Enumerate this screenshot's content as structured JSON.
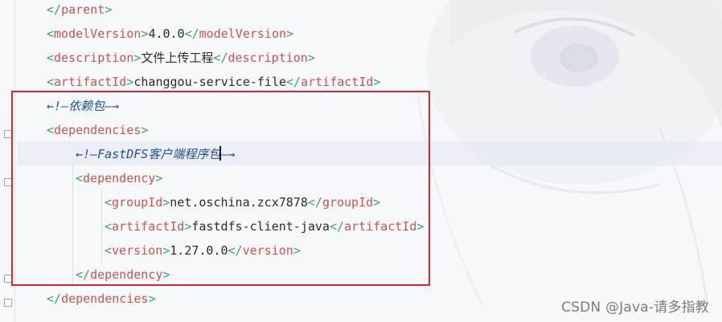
{
  "colors": {
    "tag": "#c75450",
    "bracket": "#3aa177",
    "text": "#2b2b2b",
    "comment": "#1f4f8a",
    "highlight_border": "#d9262e"
  },
  "code": {
    "line1_close_tag": "parent",
    "line2_tag": "modelVersion",
    "line2_value": "4.0.0",
    "line3_tag": "description",
    "line3_value": "文件上传工程",
    "line4_tag": "artifactId",
    "line4_value": "changgou-service-file",
    "line5_comment": "依赖包",
    "line6_tag": "dependencies",
    "line7_comment_latin": "FastDFS",
    "line7_comment_cjk": "客户端程序包",
    "line8_tag": "dependency",
    "line9_tag": "groupId",
    "line9_value": "net.oschina.zcx7878",
    "line10_tag": "artifactId",
    "line10_value": "fastdfs-client-java",
    "line11_tag": "version",
    "line11_value": "1.27.0.0",
    "line12_close_tag": "dependency",
    "line13_close_tag": "dependencies"
  },
  "glyphs": {
    "comment_open": "←!—",
    "comment_close": "—→"
  },
  "watermark": "CSDN @Java-请多指教"
}
